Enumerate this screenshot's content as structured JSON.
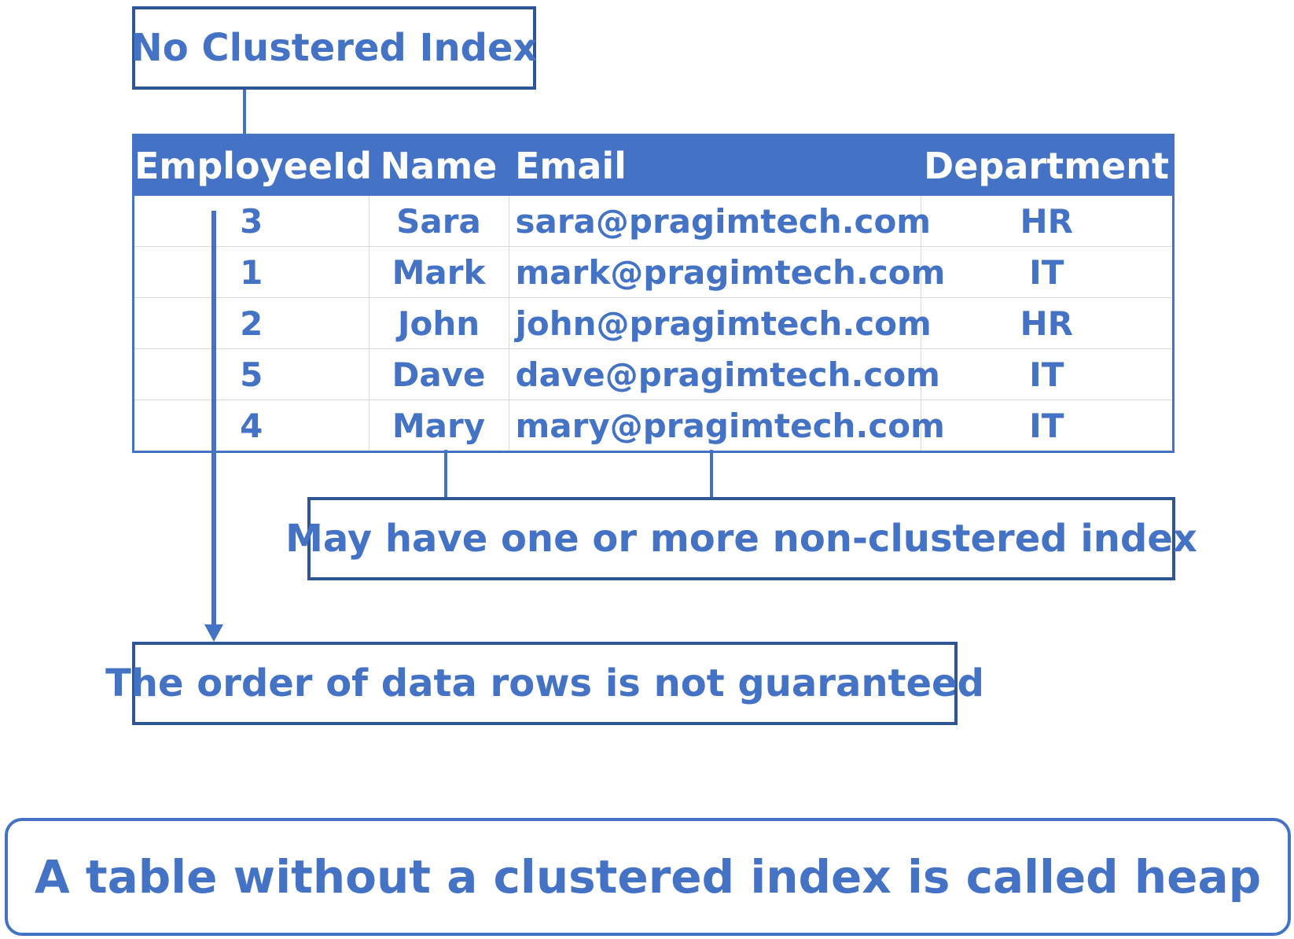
{
  "callouts": {
    "no_clustered": "No Clustered Index",
    "non_clustered": "May have one or more non-clustered index",
    "order": "The order of data rows is not guaranteed",
    "heap": "A table without a clustered index is called heap"
  },
  "table": {
    "headers": [
      "EmployeeId",
      "Name",
      "Email",
      "Department"
    ],
    "rows": [
      [
        "3",
        "Sara",
        "sara@pragimtech.com",
        "HR"
      ],
      [
        "1",
        "Mark",
        "mark@pragimtech.com",
        "IT"
      ],
      [
        "2",
        "John",
        "john@pragimtech.com",
        "HR"
      ],
      [
        "5",
        "Dave",
        "dave@pragimtech.com",
        "IT"
      ],
      [
        "4",
        "Mary",
        "mary@pragimtech.com",
        "IT"
      ]
    ]
  },
  "colors": {
    "accent": "#4472C4",
    "border_dark": "#2F5597",
    "grid": "#d9d9d9"
  }
}
